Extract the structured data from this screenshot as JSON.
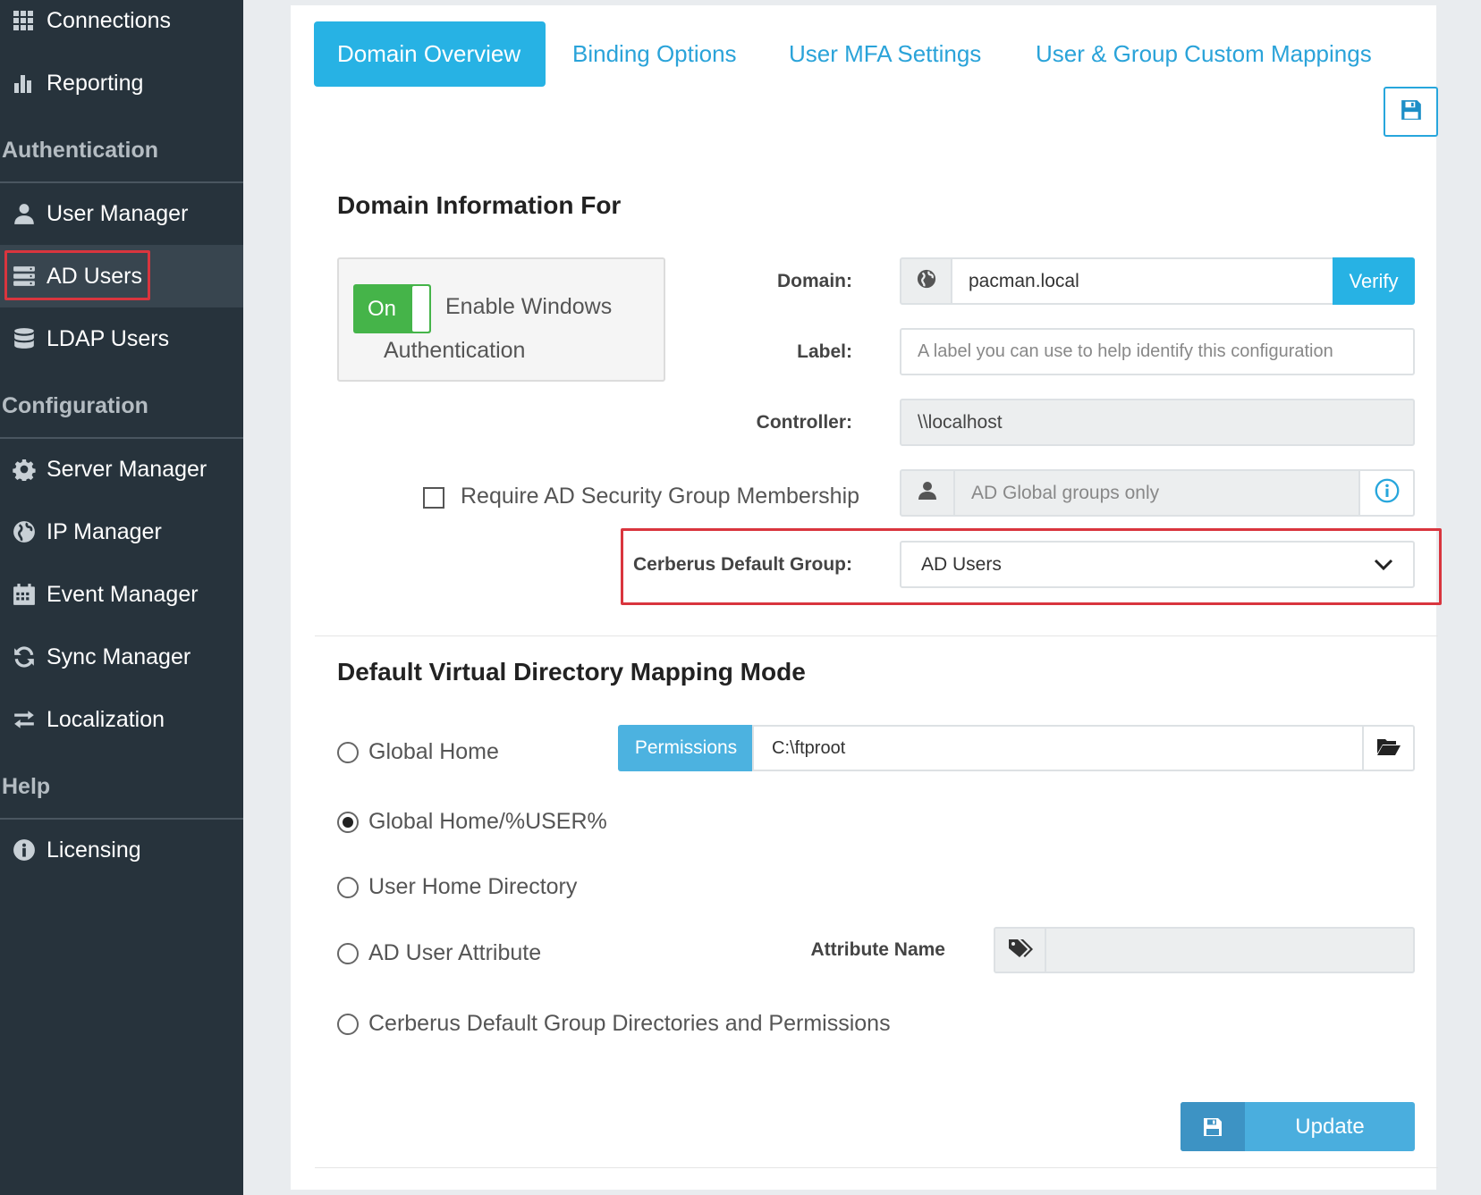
{
  "sidebar": {
    "items_top": [
      {
        "label": "Connections",
        "icon": "grid-icon"
      },
      {
        "label": "Reporting",
        "icon": "bar-chart-icon"
      }
    ],
    "sections": [
      {
        "header": "Authentication",
        "items": [
          {
            "label": "User Manager",
            "icon": "user-icon"
          },
          {
            "label": "AD Users",
            "icon": "server-icon"
          },
          {
            "label": "LDAP Users",
            "icon": "database-icon"
          }
        ]
      },
      {
        "header": "Configuration",
        "items": [
          {
            "label": "Server Manager",
            "icon": "gear-icon"
          },
          {
            "label": "IP Manager",
            "icon": "globe-icon"
          },
          {
            "label": "Event Manager",
            "icon": "calendar-icon"
          },
          {
            "label": "Sync Manager",
            "icon": "refresh-icon"
          },
          {
            "label": "Localization",
            "icon": "exchange-icon"
          }
        ]
      },
      {
        "header": "Help",
        "items": [
          {
            "label": "Licensing",
            "icon": "info-icon"
          }
        ]
      }
    ],
    "active_item": "AD Users"
  },
  "tabs": [
    {
      "label": "Domain Overview",
      "active": true
    },
    {
      "label": "Binding Options",
      "active": false
    },
    {
      "label": "User MFA Settings",
      "active": false
    },
    {
      "label": "User & Group Custom Mappings",
      "active": false
    }
  ],
  "domain_info": {
    "title": "Domain Information For",
    "toggle": {
      "state": "On",
      "label_line1": "Enable Windows",
      "label_line2": "Authentication"
    },
    "domain": {
      "label": "Domain:",
      "value": "pacman.local",
      "verify_label": "Verify"
    },
    "label_field": {
      "label": "Label:",
      "placeholder": "A label you can use to help identify this configuration"
    },
    "controller": {
      "label": "Controller:",
      "value": "\\\\localhost"
    },
    "require_group": {
      "label": "Require AD Security Group Membership",
      "checked": false,
      "placeholder": "AD Global groups only"
    },
    "default_group": {
      "label": "Cerberus Default Group:",
      "value": "AD Users"
    }
  },
  "mapping": {
    "title": "Default Virtual Directory Mapping Mode",
    "options": [
      {
        "label": "Global Home",
        "checked": false
      },
      {
        "label": "Global Home/%USER%",
        "checked": true
      },
      {
        "label": "User Home Directory",
        "checked": false
      },
      {
        "label": "AD User Attribute",
        "checked": false
      },
      {
        "label": "Cerberus Default Group Directories and Permissions",
        "checked": false
      }
    ],
    "permissions_label": "Permissions",
    "path_value": "C:\\ftproot",
    "attribute_name_label": "Attribute Name",
    "attribute_value": ""
  },
  "update_label": "Update",
  "colors": {
    "accent": "#27b2e4",
    "sidebar_bg": "#27333c",
    "toggle_on": "#45b449",
    "highlight": "#d9353e"
  }
}
